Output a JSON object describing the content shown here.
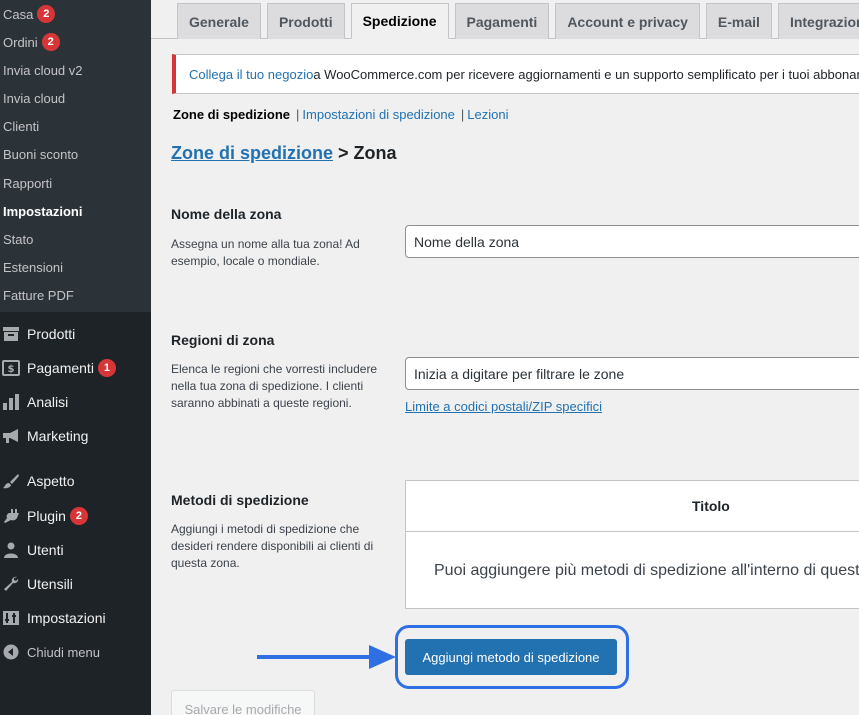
{
  "sidebar": {
    "submenu": [
      {
        "label": "Casa",
        "badge": "2"
      },
      {
        "label": "Ordini",
        "badge": "2"
      },
      {
        "label": "Invia cloud v2"
      },
      {
        "label": "Invia cloud"
      },
      {
        "label": "Clienti"
      },
      {
        "label": "Buoni sconto"
      },
      {
        "label": "Rapporti"
      },
      {
        "label": "Impostazioni",
        "current": true
      },
      {
        "label": "Stato"
      },
      {
        "label": "Estensioni"
      },
      {
        "label": "Fatture PDF"
      }
    ],
    "menu": [
      {
        "label": "Prodotti",
        "icon": "archive-icon"
      },
      {
        "label": "Pagamenti",
        "icon": "dollar-icon",
        "badge": "1"
      },
      {
        "label": "Analisi",
        "icon": "bar-chart-icon"
      },
      {
        "label": "Marketing",
        "icon": "megaphone-icon"
      },
      {
        "label": "Aspetto",
        "icon": "paintbrush-icon"
      },
      {
        "label": "Plugin",
        "icon": "plugin-icon",
        "badge": "2"
      },
      {
        "label": "Utenti",
        "icon": "user-icon"
      },
      {
        "label": "Utensili",
        "icon": "wrench-icon"
      },
      {
        "label": "Impostazioni",
        "icon": "settings-icon"
      },
      {
        "label": "Chiudi menu",
        "icon": "collapse-icon"
      }
    ]
  },
  "tabs": [
    "Generale",
    "Prodotti",
    "Spedizione",
    "Pagamenti",
    "Account e privacy",
    "E-mail",
    "Integrazione"
  ],
  "active_tab": "Spedizione",
  "notice": {
    "link": "Collega il tuo negozio",
    "text": " a WooCommerce.com per ricevere aggiornamenti e un supporto semplificato per i tuoi abbonamenti."
  },
  "subsub": {
    "current": "Zone di spedizione",
    "link1": "Impostazioni di spedizione",
    "link2": "Lezioni"
  },
  "breadcrumb": {
    "link": "Zone di spedizione",
    "rest": " > Zona"
  },
  "zone_name": {
    "title": "Nome della zona",
    "desc": "Assegna un nome alla tua zona! Ad esempio, locale o mondiale.",
    "placeholder": "Nome della zona"
  },
  "zone_regions": {
    "title": "Regioni di zona",
    "desc": "Elenca le regioni che vorresti includere nella tua zona di spedizione. I clienti saranno abbinati a queste regioni.",
    "placeholder": "Inizia a digitare per filtrare le zone",
    "postcode_link": "Limite a codici postali/ZIP specifici"
  },
  "methods": {
    "title": "Metodi di spedizione",
    "desc": "Aggiungi i metodi di spedizione che desideri rendere disponibili ai clienti di questa zona.",
    "col_title": "Titolo",
    "empty_text": "Puoi aggiungere più metodi di spedizione all'interno di questa zona.",
    "add_button": "Aggiungi metodo di spedizione"
  },
  "save_button": "Salvare le modifiche",
  "colors": {
    "sidebar_bg": "#1d2327",
    "submenu_bg": "#2c3338",
    "accent_blue": "#2271b1",
    "badge_red": "#d63638",
    "highlight_blue": "#2f6fe4"
  }
}
